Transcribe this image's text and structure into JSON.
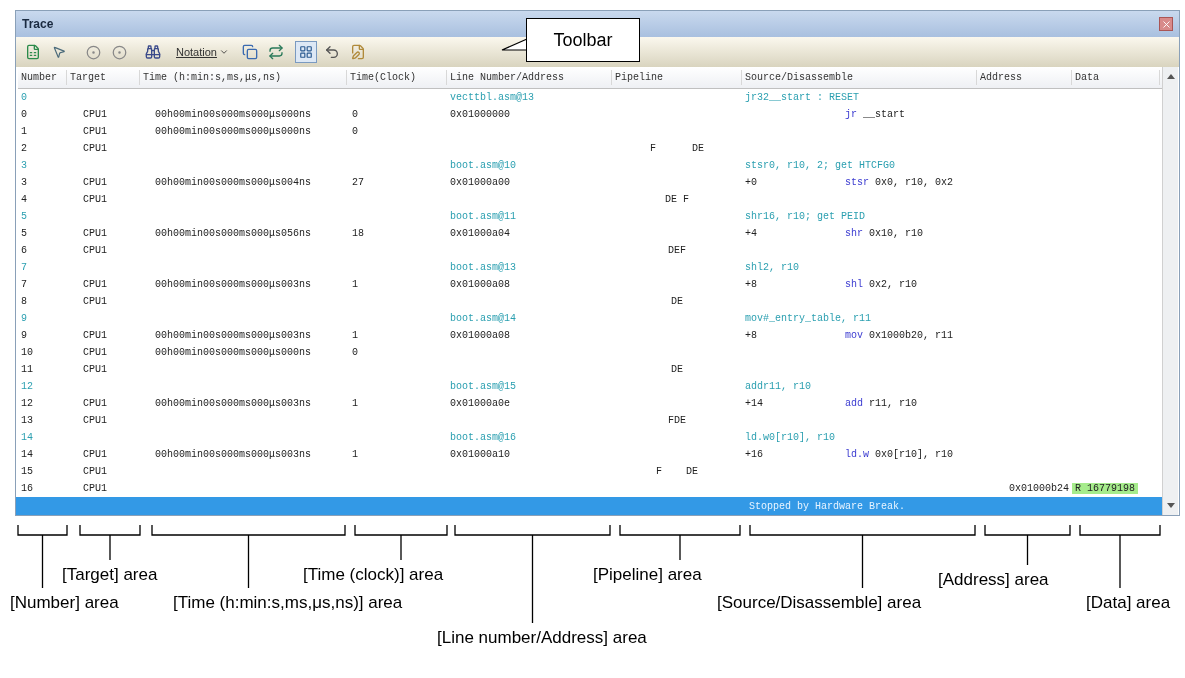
{
  "window": {
    "title": "Trace"
  },
  "toolbar": {
    "notation_button": "Notation"
  },
  "callout": "Toolbar",
  "columns": [
    "Number",
    "Target",
    "Time (h:min:s,ms,μs,ns)",
    "Time(Clock)",
    "Line Number/Address",
    "Pipeline",
    "Source/Disassemble",
    "Address",
    "Data"
  ],
  "rows": [
    {
      "kind": "source",
      "number": "0",
      "line": "vecttbl.asm@13",
      "source": "jr32__start : RESET"
    },
    {
      "kind": "trace",
      "number": "0",
      "target": "CPU1",
      "time": "00h00min00s000ms000μs000ns",
      "clock": "0",
      "line": "0x01000000",
      "mnemonic": "jr",
      "operands": "__start"
    },
    {
      "kind": "trace",
      "number": "1",
      "target": "CPU1",
      "time": "00h00min00s000ms000μs000ns",
      "clock": "0"
    },
    {
      "kind": "trace",
      "number": "2",
      "target": "CPU1",
      "pipeline": "F      DE"
    },
    {
      "kind": "source",
      "number": "3",
      "line": "boot.asm@10",
      "source": "stsr0, r10, 2; get HTCFG0"
    },
    {
      "kind": "trace",
      "number": "3",
      "target": "CPU1",
      "time": "00h00min00s000ms000μs004ns",
      "clock": "27",
      "line": "0x01000a00",
      "offset": "+0",
      "mnemonic": "stsr",
      "operands": "0x0, r10, 0x2"
    },
    {
      "kind": "trace",
      "number": "4",
      "target": "CPU1",
      "pipeline": "DE F"
    },
    {
      "kind": "source",
      "number": "5",
      "line": "boot.asm@11",
      "source": "shr16, r10; get PEID"
    },
    {
      "kind": "trace",
      "number": "5",
      "target": "CPU1",
      "time": "00h00min00s000ms000μs056ns",
      "clock": "18",
      "line": "0x01000a04",
      "offset": "+4",
      "mnemonic": "shr",
      "operands": "0x10, r10"
    },
    {
      "kind": "trace",
      "number": "6",
      "target": "CPU1",
      "pipeline": "DEF"
    },
    {
      "kind": "source",
      "number": "7",
      "line": "boot.asm@13",
      "source": "shl2, r10"
    },
    {
      "kind": "trace",
      "number": "7",
      "target": "CPU1",
      "time": "00h00min00s000ms000μs003ns",
      "clock": "1",
      "line": "0x01000a08",
      "offset": "+8",
      "mnemonic": "shl",
      "operands": "0x2, r10"
    },
    {
      "kind": "trace",
      "number": "8",
      "target": "CPU1",
      "pipeline": "DE"
    },
    {
      "kind": "source",
      "number": "9",
      "line": "boot.asm@14",
      "source": "mov#_entry_table, r11"
    },
    {
      "kind": "trace",
      "number": "9",
      "target": "CPU1",
      "time": "00h00min00s000ms000μs003ns",
      "clock": "1",
      "line": "0x01000a08",
      "offset": "+8",
      "mnemonic": "mov",
      "operands": "0x1000b20, r11"
    },
    {
      "kind": "trace",
      "number": "10",
      "target": "CPU1",
      "time": "00h00min00s000ms000μs000ns",
      "clock": "0"
    },
    {
      "kind": "trace",
      "number": "11",
      "target": "CPU1",
      "pipeline": "DE"
    },
    {
      "kind": "source",
      "number": "12",
      "line": "boot.asm@15",
      "source": "addr11, r10"
    },
    {
      "kind": "trace",
      "number": "12",
      "target": "CPU1",
      "time": "00h00min00s000ms000μs003ns",
      "clock": "1",
      "line": "0x01000a0e",
      "offset": "+14",
      "mnemonic": "add",
      "operands": "r11, r10"
    },
    {
      "kind": "trace",
      "number": "13",
      "target": "CPU1",
      "pipeline": "FDE"
    },
    {
      "kind": "source",
      "number": "14",
      "line": "boot.asm@16",
      "source": "ld.w0[r10], r10"
    },
    {
      "kind": "trace",
      "number": "14",
      "target": "CPU1",
      "time": "00h00min00s000ms000μs003ns",
      "clock": "1",
      "line": "0x01000a10",
      "offset": "+16",
      "mnemonic": "ld.w",
      "operands": "0x0[r10], r10"
    },
    {
      "kind": "trace",
      "number": "15",
      "target": "CPU1",
      "pipeline": "F    DE"
    },
    {
      "kind": "trace",
      "number": "16",
      "target": "CPU1",
      "address": "0x01000b24",
      "data": "R 16779198",
      "data_highlight": true
    }
  ],
  "status": "Stopped by Hardware Break.",
  "area_labels": [
    "[Target] area",
    "[Time (clock)] area",
    "[Pipeline] area",
    "[Address] area",
    "[Number] area",
    "[Time (h:min:s,ms,μs,ns)] area",
    "[Source/Disassemble] area",
    "[Data] area",
    "[Line number/Address] area"
  ]
}
